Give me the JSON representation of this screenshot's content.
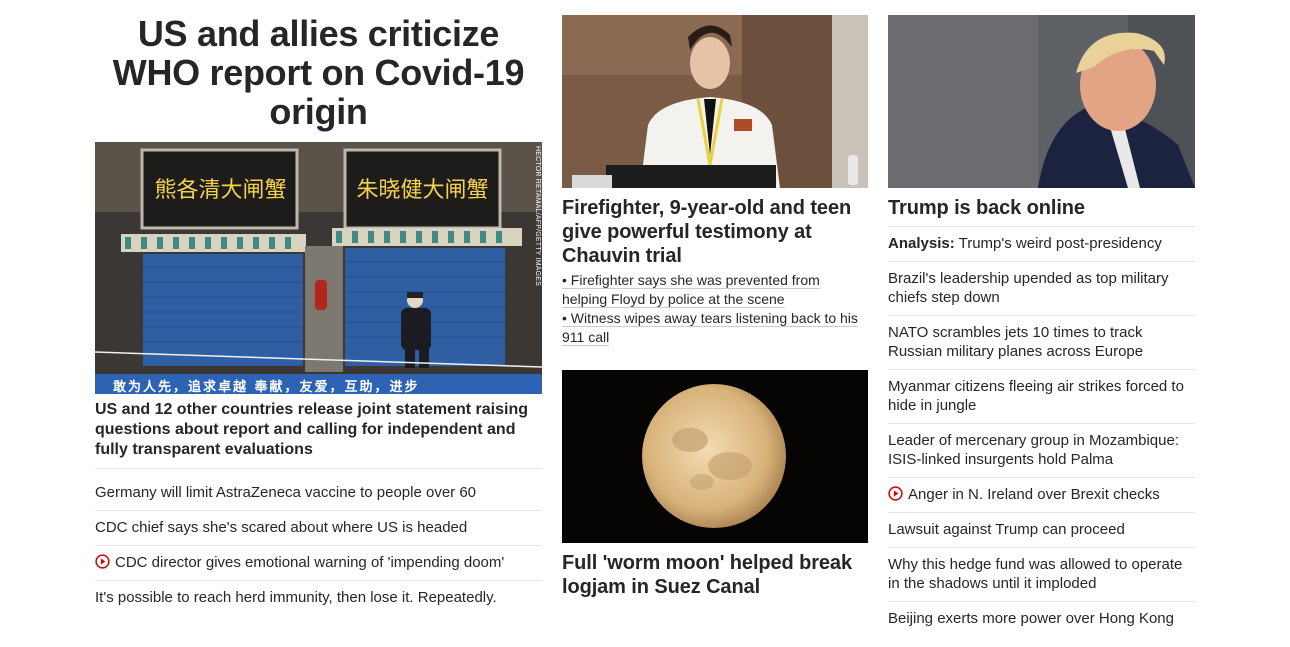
{
  "col1": {
    "headline": "US and allies criticize WHO report on Covid-19 origin",
    "image": {
      "credit": "HECTOR RETAMAL/AFP/GETTY IMAGES",
      "sign_left": "熊各清大闸蟹",
      "sign_right": "朱晓健大闸蟹",
      "banner": "敢为人先，追求卓越   奉献，友爱，互助，进步"
    },
    "lead_description": "US and 12 other countries release joint statement raising questions about report and calling for independent and fully transparent evaluations",
    "items": [
      {
        "text": "Germany will limit AstraZeneca vaccine to people over 60",
        "video": false
      },
      {
        "text": "CDC chief says she's scared about where US is headed",
        "video": false
      },
      {
        "text": "CDC director gives emotional warning of 'impending doom'",
        "video": true
      },
      {
        "text": "It's possible to reach herd immunity, then lose it. Repeatedly.",
        "video": false
      }
    ]
  },
  "col2": {
    "story1": {
      "headline": "Firefighter, 9-year-old and teen give powerful testimony at Chauvin trial",
      "bullets": [
        "• Firefighter says she was prevented from helping Floyd by police at the scene",
        "• Witness wipes away tears listening back to his 911 call"
      ]
    },
    "story2": {
      "headline": "Full 'worm moon' helped break logjam in Suez Canal"
    }
  },
  "col3": {
    "headline": "Trump is back online",
    "items": [
      {
        "prefix": "Analysis:",
        "text": "Trump's weird post-presidency",
        "video": false
      },
      {
        "prefix": "",
        "text": "Brazil's leadership upended as top military chiefs step down",
        "video": false
      },
      {
        "prefix": "",
        "text": "NATO scrambles jets 10 times to track Russian military planes across Europe",
        "video": false
      },
      {
        "prefix": "",
        "text": "Myanmar citizens fleeing air strikes forced to hide in jungle",
        "video": false
      },
      {
        "prefix": "",
        "text": "Leader of mercenary group in Mozambique: ISIS-linked insurgents hold Palma",
        "video": false
      },
      {
        "prefix": "",
        "text": "Anger in N. Ireland over Brexit checks",
        "video": true
      },
      {
        "prefix": "",
        "text": "Lawsuit against Trump can proceed",
        "video": false
      },
      {
        "prefix": "",
        "text": "Why this hedge fund was allowed to operate in the shadows until it imploded",
        "video": false
      },
      {
        "prefix": "",
        "text": "Beijing exerts more power over Hong Kong",
        "video": false
      }
    ]
  },
  "colors": {
    "text": "#262626",
    "divider": "#e6e6e6",
    "video_icon": "#cc0000"
  },
  "icons": {
    "video": "play-circle-icon"
  }
}
